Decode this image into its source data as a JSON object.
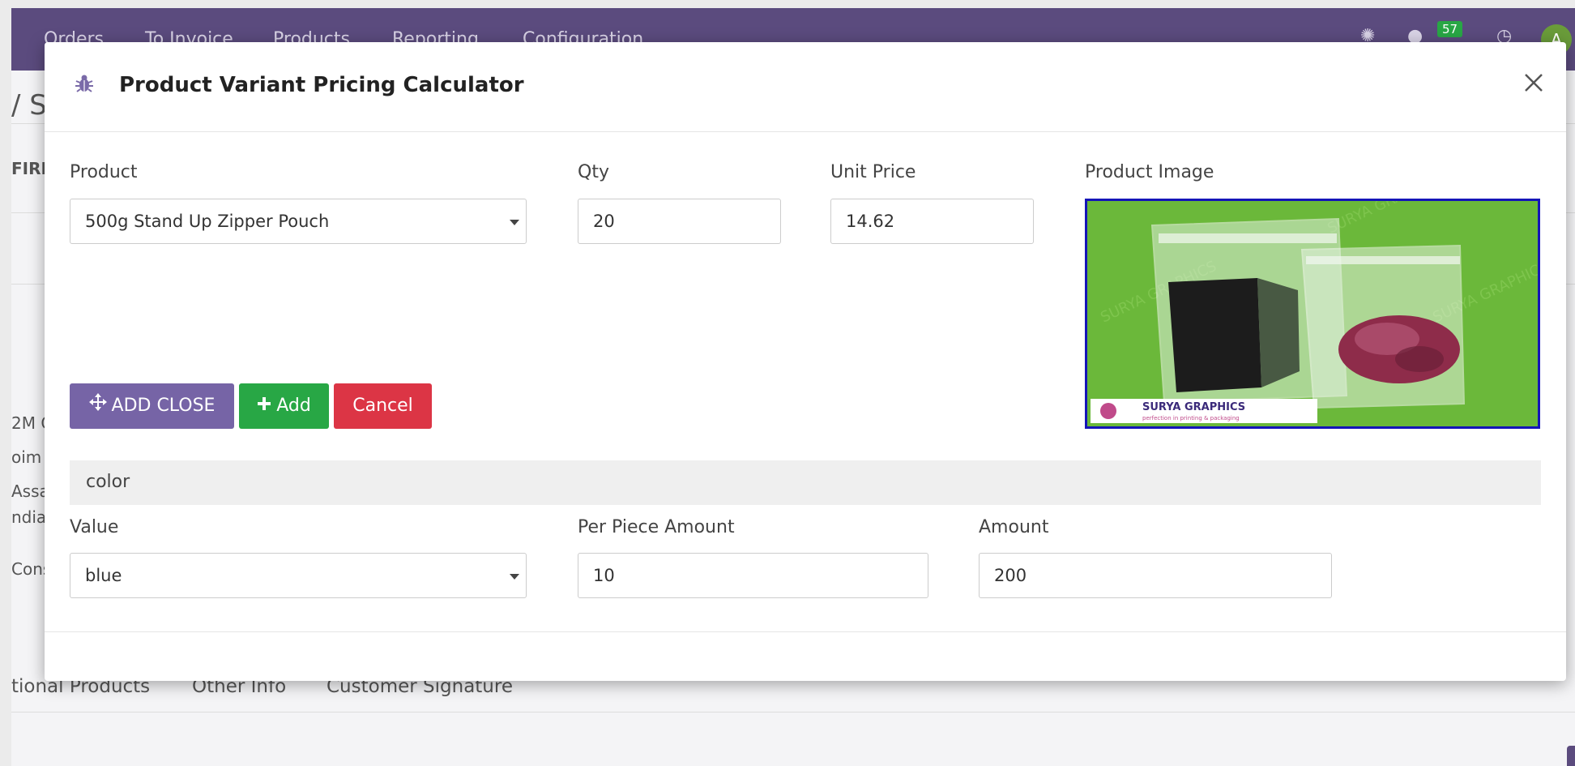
{
  "navbar": {
    "items": [
      "Orders",
      "To Invoice",
      "Products",
      "Reporting",
      "Configuration"
    ],
    "messages_badge": "57",
    "avatar_letter": "A"
  },
  "background": {
    "breadcrumb_fragment": "/ S",
    "status_fragment": "FIRI",
    "address_lines": [
      "2M C",
      "oim",
      "Assa",
      "ndia"
    ],
    "label_fragment": "Cons",
    "tabs": [
      "tional Products",
      "Other Info",
      "Customer Signature"
    ]
  },
  "modal": {
    "title": "Product Variant Pricing Calculator",
    "product_label": "Product",
    "product_value": "500g Stand Up Zipper Pouch",
    "qty_label": "Qty",
    "qty_value": "20",
    "unit_price_label": "Unit Price",
    "unit_price_value": "14.62",
    "image_label": "Product Image",
    "image": {
      "watermark": "SURYA GRAPHICS",
      "brand_main": "SURYA GRAPHICS",
      "tagline": "perfection in printing & packaging"
    },
    "buttons": {
      "add_close": "ADD CLOSE",
      "add": "Add",
      "cancel": "Cancel"
    },
    "attribute": {
      "name": "color",
      "value_label": "Value",
      "value": "blue",
      "per_piece_label": "Per Piece Amount",
      "per_piece_value": "10",
      "amount_label": "Amount",
      "amount_value": "200"
    }
  },
  "colors": {
    "navbar": "#5b4b7e",
    "add_close_button": "#7664a6",
    "add_button": "#28a745",
    "cancel_button": "#dc3545",
    "image_border": "#1515b8",
    "image_background": "#6bb83a"
  }
}
